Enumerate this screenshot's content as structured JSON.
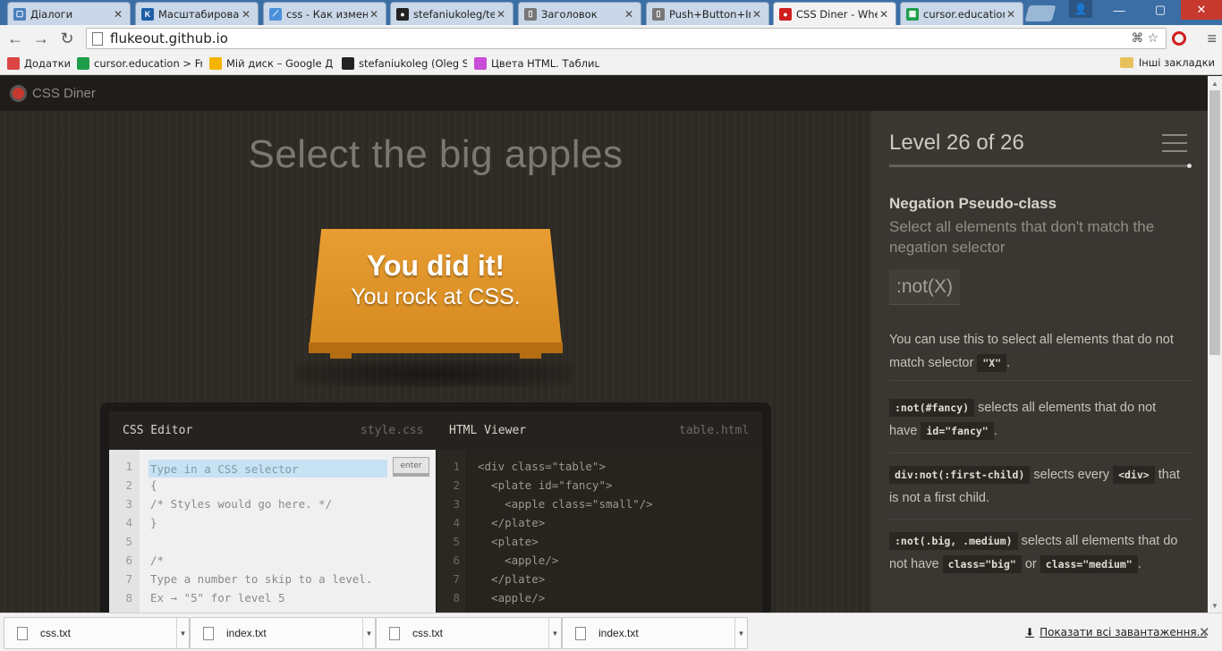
{
  "browser": {
    "tabs": [
      {
        "title": "Діалоги",
        "color": "#4a7fbf",
        "glyph": "▢"
      },
      {
        "title": "Масштабирован",
        "color": "#1d5fa6",
        "glyph": "K"
      },
      {
        "title": "css - Как измен",
        "color": "#4a90d9",
        "glyph": "⟋"
      },
      {
        "title": "stefaniukoleg/te",
        "color": "#222222",
        "glyph": "●"
      },
      {
        "title": "Заголовок",
        "color": "#777777",
        "glyph": "▯"
      },
      {
        "title": "Push+Button+Ir",
        "color": "#777777",
        "glyph": "▯"
      },
      {
        "title": "CSS Diner - Whe",
        "color": "#d01e1e",
        "glyph": "●"
      },
      {
        "title": "cursor.educatior",
        "color": "#1e9e4a",
        "glyph": "▦"
      }
    ],
    "url": "flukeout.github.io",
    "bookmarks": [
      {
        "label": "Додатки",
        "color": "#d44"
      },
      {
        "label": "cursor.education > Fr",
        "color": "#1e9e4a"
      },
      {
        "label": "Мій диск – Google Д",
        "color": "#f4b400"
      },
      {
        "label": "stefaniukoleg (Oleg St",
        "color": "#222222"
      },
      {
        "label": "Цвета HTML. Таблиця",
        "color": "#c94cd6"
      }
    ],
    "bookmarks_other": "Інші закладки"
  },
  "app": {
    "logo": "CSS Diner",
    "order": "Select the big apples",
    "win_big": "You did it!",
    "win_small": "You rock at CSS."
  },
  "editor": {
    "css_title": "CSS Editor",
    "css_file": "style.css",
    "html_title": "HTML Viewer",
    "html_file": "table.html",
    "css_placeholder": "Type in a CSS selector",
    "enter_label": "enter",
    "css_lines": [
      "",
      "{",
      "/* Styles would go here. */",
      "}",
      "",
      "/*",
      "Type a number to skip to a level.",
      "Ex → \"5\" for level 5"
    ],
    "html_lines": [
      "<div class=\"table\">",
      "  <plate id=\"fancy\">",
      "    <apple class=\"small\"/>",
      "  </plate>",
      "  <plate>",
      "    <apple/>",
      "  </plate>",
      "  <apple/>"
    ]
  },
  "sidebar": {
    "level": "Level 26 of 26",
    "progress": 1.0,
    "selector_name": "Negation Pseudo-class",
    "title": "Select all elements that don't match the negation selector",
    "syntax": ":not(X)",
    "hint_pre": "You can use this to select all elements that do not match selector",
    "hint_tag": "\"X\"",
    "hint_post": ".",
    "ex1_tag": ":not(#fancy)",
    "ex1_text": " selects all elements that do not have ",
    "ex1_tag2": "id=\"fancy\"",
    "ex1_post": ".",
    "ex2_tag": "div:not(:first-child)",
    "ex2_text": " selects every ",
    "ex2_tag2": "<div>",
    "ex2_post": " that is not a first child.",
    "ex3_tag": ":not(.big, .medium)",
    "ex3_text": " selects all elements that do not have ",
    "ex3_tag2": "class=\"big\"",
    "ex3_mid": " or ",
    "ex3_tag3": "class=\"medium\"",
    "ex3_post": "."
  },
  "downloads": {
    "items": [
      "css.txt",
      "index.txt",
      "css.txt",
      "index.txt"
    ],
    "show_all": "Показати всі завантаження..."
  }
}
